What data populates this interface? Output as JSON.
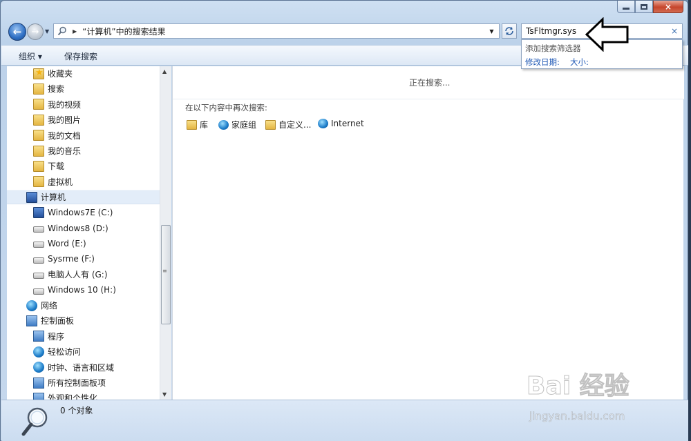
{
  "window": {
    "close_glyph": "×"
  },
  "nav": {
    "back_glyph": "←",
    "forward_glyph": "→"
  },
  "address": {
    "text": "“计算机”中的搜索结果"
  },
  "search": {
    "value": "TsFltmgr.sys",
    "clear_glyph": "×"
  },
  "suggest": {
    "header": "添加搜索筛选器",
    "filter_date": "修改日期:",
    "filter_size": "大小:"
  },
  "toolbar": {
    "organize": "组织 ▾",
    "save_search": "保存搜索"
  },
  "navpane": {
    "items": [
      {
        "label": "收藏夹",
        "icon": "favorites-star-icon",
        "level": 1
      },
      {
        "label": "搜索",
        "icon": "folder-icon",
        "level": 1
      },
      {
        "label": "我的视频",
        "icon": "folder-icon",
        "level": 1
      },
      {
        "label": "我的图片",
        "icon": "folder-icon",
        "level": 1
      },
      {
        "label": "我的文档",
        "icon": "folder-icon",
        "level": 1
      },
      {
        "label": "我的音乐",
        "icon": "folder-icon",
        "level": 1
      },
      {
        "label": "下载",
        "icon": "folder-icon",
        "level": 1
      },
      {
        "label": "虚拟机",
        "icon": "folder-icon",
        "level": 1
      },
      {
        "label": "计算机",
        "icon": "computer-icon",
        "level": 0,
        "selected": true
      },
      {
        "label": "Windows7E (C:)",
        "icon": "system-drive-icon",
        "level": 1
      },
      {
        "label": "Windows8 (D:)",
        "icon": "drive-icon",
        "level": 1
      },
      {
        "label": "Word (E:)",
        "icon": "drive-icon",
        "level": 1
      },
      {
        "label": "Sysrme (F:)",
        "icon": "drive-icon",
        "level": 1
      },
      {
        "label": "电脑人人有 (G:)",
        "icon": "drive-icon",
        "level": 1
      },
      {
        "label": "Windows 10 (H:)",
        "icon": "drive-icon",
        "level": 1
      },
      {
        "label": "网络",
        "icon": "network-icon",
        "level": 0
      },
      {
        "label": "控制面板",
        "icon": "control-panel-icon",
        "level": 0
      },
      {
        "label": "程序",
        "icon": "programs-icon",
        "level": 1
      },
      {
        "label": "轻松访问",
        "icon": "ease-of-access-icon",
        "level": 1
      },
      {
        "label": "时钟、语言和区域",
        "icon": "clock-globe-icon",
        "level": 1
      },
      {
        "label": "所有控制面板项",
        "icon": "control-panel-icon",
        "level": 1
      },
      {
        "label": "外观和个性化",
        "icon": "appearance-icon",
        "level": 1
      }
    ]
  },
  "content": {
    "searching": "正在搜索...",
    "search_again": "在以下内容中再次搜索:",
    "locations": [
      {
        "label": "库",
        "icon": "library-icon"
      },
      {
        "label": "家庭组",
        "icon": "homegroup-icon"
      },
      {
        "label": "自定义...",
        "icon": "custom-folder-icon"
      },
      {
        "label": "Internet",
        "icon": "internet-icon"
      }
    ]
  },
  "status": {
    "text": "0 个对象"
  },
  "watermark": {
    "brand": "Bai 经验",
    "url": "jingyan.baidu.com"
  }
}
